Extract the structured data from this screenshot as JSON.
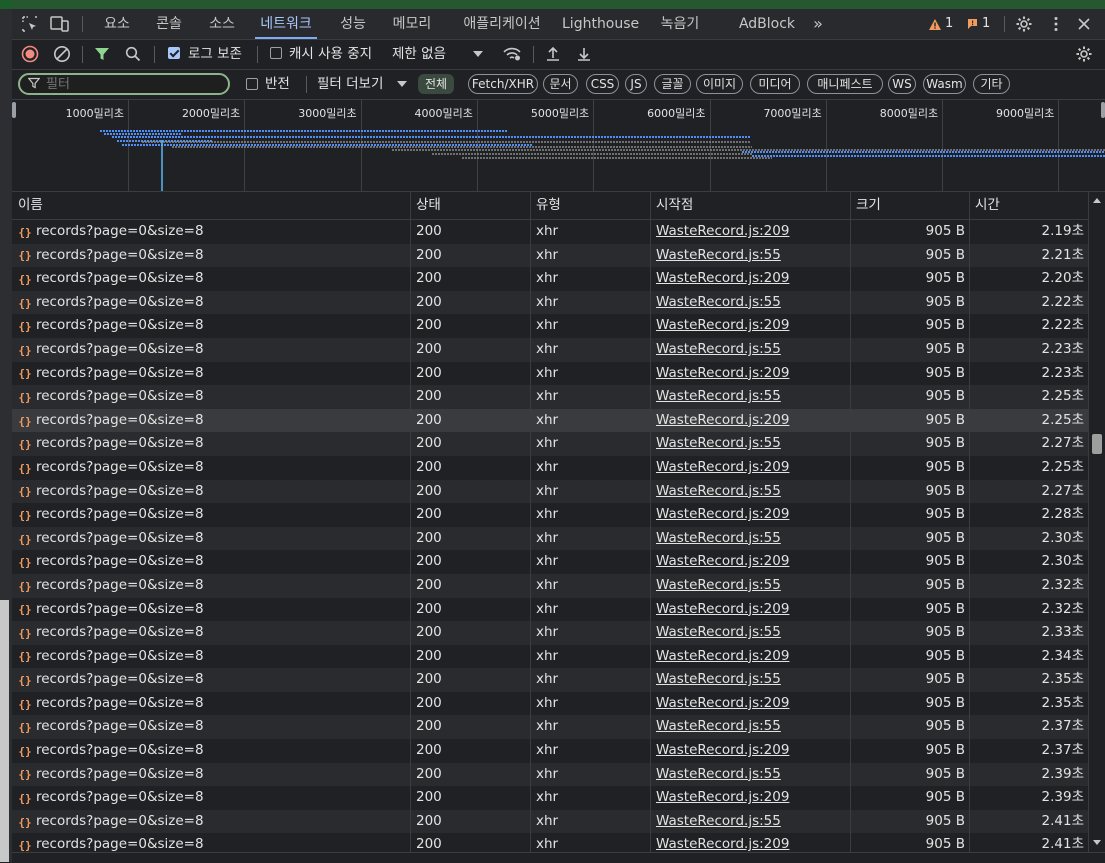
{
  "tabs": [
    "요소",
    "콘솔",
    "소스",
    "네트워크",
    "성능",
    "메모리",
    "애플리케이션",
    "Lighthouse",
    "녹음기",
    "AdBlock"
  ],
  "active_tab": "네트워크",
  "more_tabs": "»",
  "warnings_count": "1",
  "issues_count": "1",
  "toolbar": {
    "preserve_log_label": "로그 보존",
    "disable_cache_label": "캐시 사용 중지",
    "throttle_label": "제한 없음"
  },
  "filter": {
    "placeholder": "필터",
    "invert_label": "반전",
    "more_filters_label": "필터 더보기",
    "types": [
      "전체",
      "Fetch/XHR",
      "문서",
      "CSS",
      "JS",
      "글꼴",
      "이미지",
      "미디어",
      "매니페스트",
      "WS",
      "Wasm",
      "기타"
    ]
  },
  "overview": {
    "labels": [
      "1000밀리초",
      "2000밀리초",
      "3000밀리초",
      "4000밀리초",
      "5000밀리초",
      "6000밀리초",
      "7000밀리초",
      "8000밀리초",
      "9000밀리초"
    ]
  },
  "columns": {
    "name": "이름",
    "status": "상태",
    "type": "유형",
    "initiator": "시작점",
    "size": "크기",
    "time": "시간"
  },
  "rows": [
    {
      "name": "records?page=0&size=8",
      "status": "200",
      "type": "xhr",
      "initiator": "WasteRecord.js:209",
      "size": "905 B",
      "time": "2.19초"
    },
    {
      "name": "records?page=0&size=8",
      "status": "200",
      "type": "xhr",
      "initiator": "WasteRecord.js:55",
      "size": "905 B",
      "time": "2.21초"
    },
    {
      "name": "records?page=0&size=8",
      "status": "200",
      "type": "xhr",
      "initiator": "WasteRecord.js:209",
      "size": "905 B",
      "time": "2.20초"
    },
    {
      "name": "records?page=0&size=8",
      "status": "200",
      "type": "xhr",
      "initiator": "WasteRecord.js:55",
      "size": "905 B",
      "time": "2.22초"
    },
    {
      "name": "records?page=0&size=8",
      "status": "200",
      "type": "xhr",
      "initiator": "WasteRecord.js:209",
      "size": "905 B",
      "time": "2.22초"
    },
    {
      "name": "records?page=0&size=8",
      "status": "200",
      "type": "xhr",
      "initiator": "WasteRecord.js:55",
      "size": "905 B",
      "time": "2.23초"
    },
    {
      "name": "records?page=0&size=8",
      "status": "200",
      "type": "xhr",
      "initiator": "WasteRecord.js:209",
      "size": "905 B",
      "time": "2.23초"
    },
    {
      "name": "records?page=0&size=8",
      "status": "200",
      "type": "xhr",
      "initiator": "WasteRecord.js:55",
      "size": "905 B",
      "time": "2.25초"
    },
    {
      "name": "records?page=0&size=8",
      "status": "200",
      "type": "xhr",
      "initiator": "WasteRecord.js:209",
      "size": "905 B",
      "time": "2.25초"
    },
    {
      "name": "records?page=0&size=8",
      "status": "200",
      "type": "xhr",
      "initiator": "WasteRecord.js:55",
      "size": "905 B",
      "time": "2.27초"
    },
    {
      "name": "records?page=0&size=8",
      "status": "200",
      "type": "xhr",
      "initiator": "WasteRecord.js:209",
      "size": "905 B",
      "time": "2.25초"
    },
    {
      "name": "records?page=0&size=8",
      "status": "200",
      "type": "xhr",
      "initiator": "WasteRecord.js:55",
      "size": "905 B",
      "time": "2.27초"
    },
    {
      "name": "records?page=0&size=8",
      "status": "200",
      "type": "xhr",
      "initiator": "WasteRecord.js:209",
      "size": "905 B",
      "time": "2.28초"
    },
    {
      "name": "records?page=0&size=8",
      "status": "200",
      "type": "xhr",
      "initiator": "WasteRecord.js:55",
      "size": "905 B",
      "time": "2.30초"
    },
    {
      "name": "records?page=0&size=8",
      "status": "200",
      "type": "xhr",
      "initiator": "WasteRecord.js:209",
      "size": "905 B",
      "time": "2.30초"
    },
    {
      "name": "records?page=0&size=8",
      "status": "200",
      "type": "xhr",
      "initiator": "WasteRecord.js:55",
      "size": "905 B",
      "time": "2.32초"
    },
    {
      "name": "records?page=0&size=8",
      "status": "200",
      "type": "xhr",
      "initiator": "WasteRecord.js:209",
      "size": "905 B",
      "time": "2.32초"
    },
    {
      "name": "records?page=0&size=8",
      "status": "200",
      "type": "xhr",
      "initiator": "WasteRecord.js:55",
      "size": "905 B",
      "time": "2.33초"
    },
    {
      "name": "records?page=0&size=8",
      "status": "200",
      "type": "xhr",
      "initiator": "WasteRecord.js:209",
      "size": "905 B",
      "time": "2.34초"
    },
    {
      "name": "records?page=0&size=8",
      "status": "200",
      "type": "xhr",
      "initiator": "WasteRecord.js:55",
      "size": "905 B",
      "time": "2.35초"
    },
    {
      "name": "records?page=0&size=8",
      "status": "200",
      "type": "xhr",
      "initiator": "WasteRecord.js:209",
      "size": "905 B",
      "time": "2.35초"
    },
    {
      "name": "records?page=0&size=8",
      "status": "200",
      "type": "xhr",
      "initiator": "WasteRecord.js:55",
      "size": "905 B",
      "time": "2.37초"
    },
    {
      "name": "records?page=0&size=8",
      "status": "200",
      "type": "xhr",
      "initiator": "WasteRecord.js:209",
      "size": "905 B",
      "time": "2.37초"
    },
    {
      "name": "records?page=0&size=8",
      "status": "200",
      "type": "xhr",
      "initiator": "WasteRecord.js:55",
      "size": "905 B",
      "time": "2.39초"
    },
    {
      "name": "records?page=0&size=8",
      "status": "200",
      "type": "xhr",
      "initiator": "WasteRecord.js:209",
      "size": "905 B",
      "time": "2.39초"
    },
    {
      "name": "records?page=0&size=8",
      "status": "200",
      "type": "xhr",
      "initiator": "WasteRecord.js:55",
      "size": "905 B",
      "time": "2.41초"
    },
    {
      "name": "records?page=0&size=8",
      "status": "200",
      "type": "xhr",
      "initiator": "WasteRecord.js:209",
      "size": "905 B",
      "time": "2.41초"
    }
  ],
  "highlighted_row": 8,
  "colors": {
    "accent": "#a8c7fa",
    "record": "#f28b82",
    "xhr_icon": "#f29b5f",
    "waterfall_blue": "#4f8ef7",
    "waterfall_gray": "#8a8a8a",
    "cursor_line": "#5bb8f5"
  }
}
